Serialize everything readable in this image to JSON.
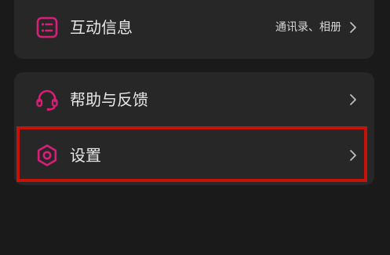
{
  "settings_list": {
    "interaction": {
      "icon": "info-list-icon",
      "label": "互动信息",
      "value": "通讯录、相册"
    },
    "help": {
      "icon": "headset-icon",
      "label": "帮助与反馈"
    },
    "settings": {
      "icon": "gear-icon",
      "label": "设置"
    }
  },
  "colors": {
    "background": "#1a1a1a",
    "card": "#272727",
    "text": "#e8e8e8",
    "accent_icon": "#d81e78",
    "highlight_border": "#c5130c"
  }
}
